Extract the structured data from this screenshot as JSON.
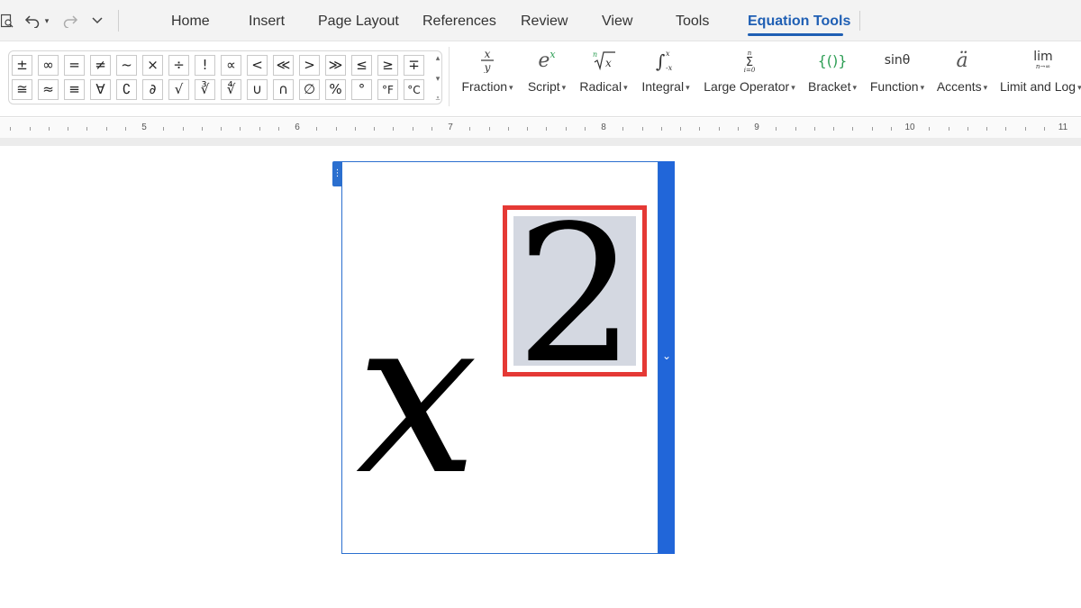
{
  "menu": {
    "tabs": [
      "Home",
      "Insert",
      "Page Layout",
      "References",
      "Review",
      "View",
      "Tools",
      "Equation Tools"
    ],
    "active_tab": "Equation Tools"
  },
  "ribbon": {
    "symbols_row1": [
      "±",
      "∞",
      "=",
      "≠",
      "~",
      "×",
      "÷",
      "!",
      "∝",
      "<",
      "≪",
      ">",
      "≫",
      "≤",
      "≥",
      "∓"
    ],
    "symbols_row2": [
      "≅",
      "≈",
      "≡",
      "∀",
      "∁",
      "∂",
      "√",
      "∛",
      "∜",
      "∪",
      "∩",
      "∅",
      "%",
      "°",
      "°F",
      "°C"
    ],
    "buttons": [
      {
        "label": "Fraction",
        "icon": "fraction-icon"
      },
      {
        "label": "Script",
        "icon": "script-icon"
      },
      {
        "label": "Radical",
        "icon": "radical-icon"
      },
      {
        "label": "Integral",
        "icon": "integral-icon"
      },
      {
        "label": "Large Operator",
        "icon": "large-operator-icon"
      },
      {
        "label": "Bracket",
        "icon": "bracket-icon"
      },
      {
        "label": "Function",
        "icon": "function-icon"
      },
      {
        "label": "Accents",
        "icon": "accents-icon"
      },
      {
        "label": "Limit and Log",
        "icon": "limit-log-icon"
      }
    ],
    "icon_text": {
      "script": "e",
      "script_sup": "x",
      "function": "sinθ",
      "accents": "ä",
      "limit": "lim",
      "limit_sub": "n→∞",
      "bracket": "{()}"
    }
  },
  "ruler": {
    "numbers": [
      "5",
      "6",
      "7",
      "8",
      "9",
      "10",
      "11"
    ]
  },
  "equation": {
    "base": "x",
    "exponent": "2"
  },
  "colors": {
    "accent": "#1f5fb4",
    "frame": "#2166d9",
    "highlight_border": "#e53935",
    "selection": "#d4d8e1"
  }
}
